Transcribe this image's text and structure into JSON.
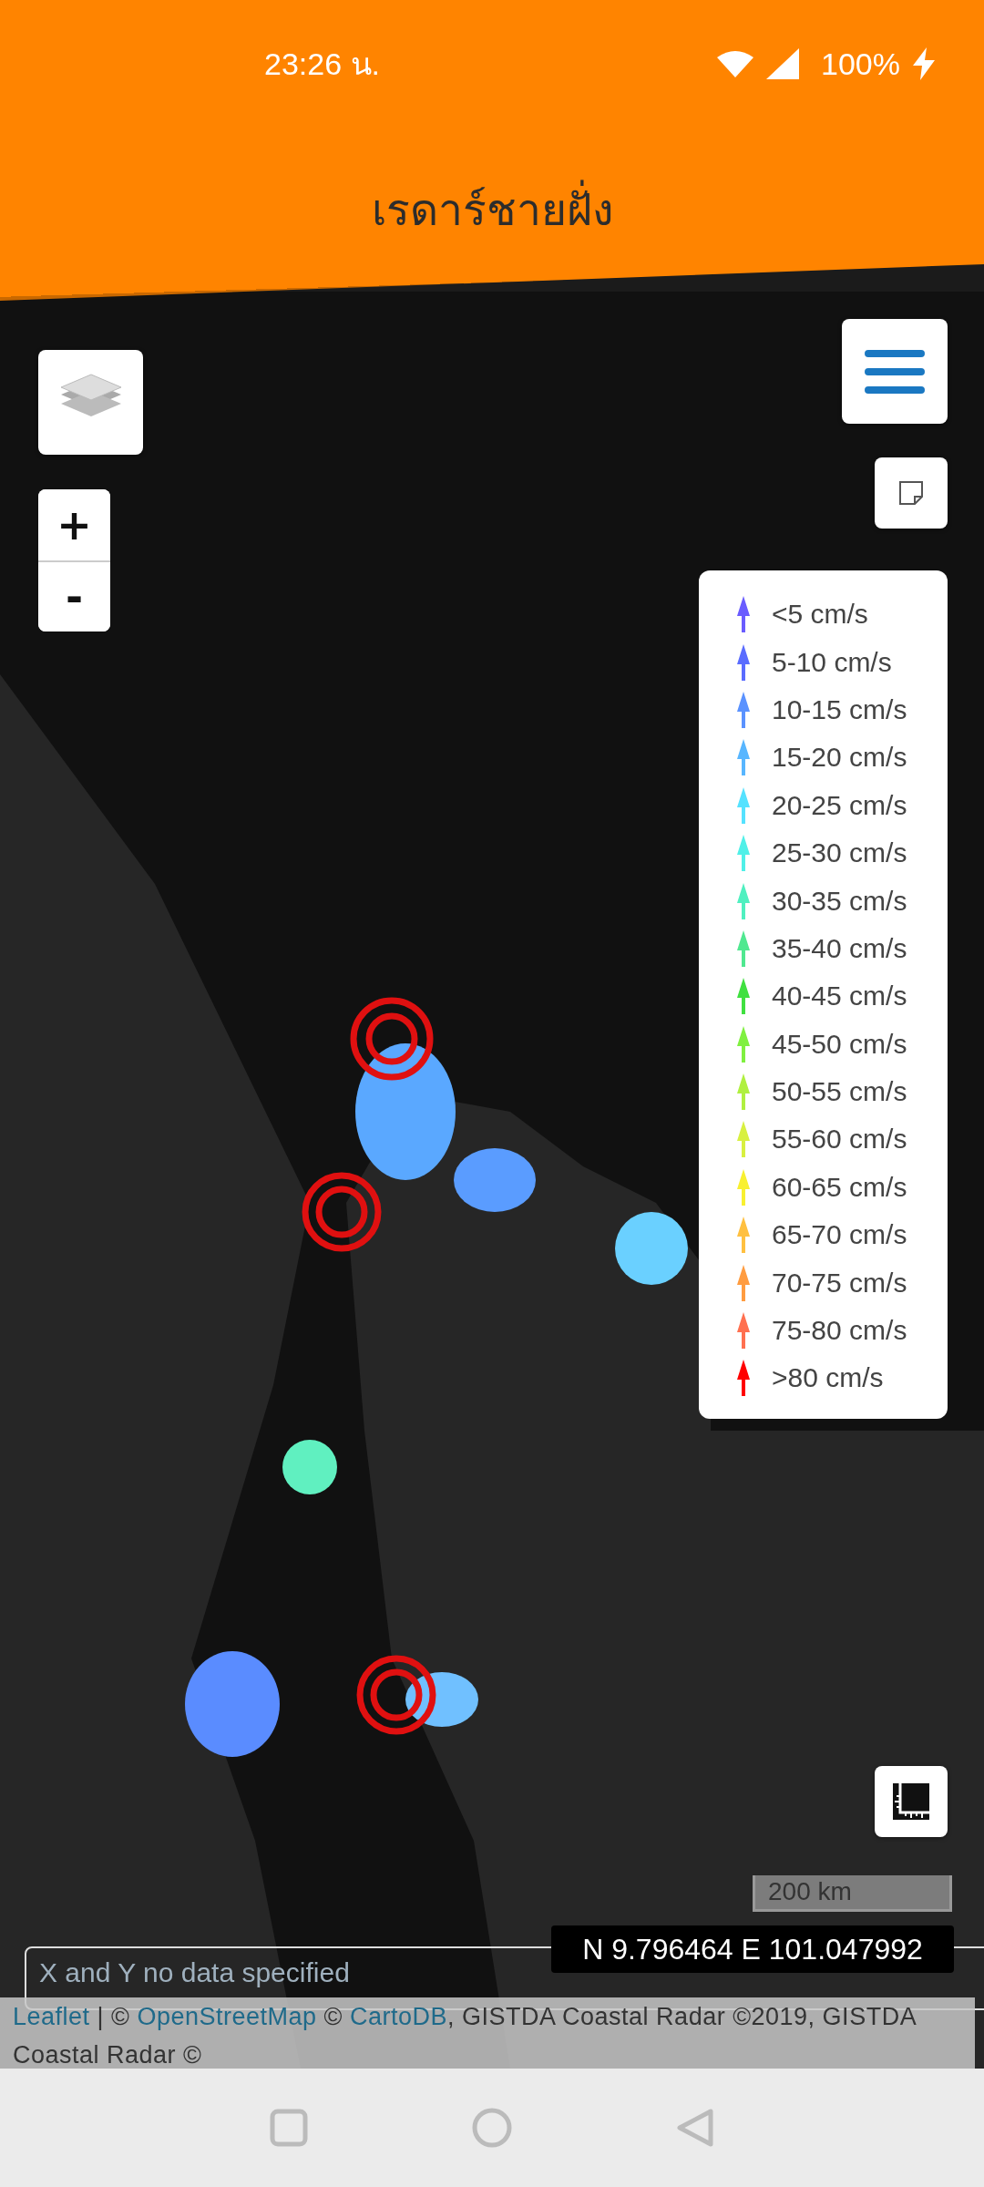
{
  "status_bar": {
    "time": "23:26 น.",
    "battery": "100%"
  },
  "header": {
    "title": "เรดาร์ชายฝั่ง"
  },
  "zoom": {
    "zoom_in": "+",
    "zoom_out": "-"
  },
  "legend": [
    {
      "label": "<5 cm/s",
      "color": "#6a5cff"
    },
    {
      "label": "5-10 cm/s",
      "color": "#5a6cff"
    },
    {
      "label": "10-15 cm/s",
      "color": "#5a92ff"
    },
    {
      "label": "15-20 cm/s",
      "color": "#58b6ff"
    },
    {
      "label": "20-25 cm/s",
      "color": "#55e2ff"
    },
    {
      "label": "25-30 cm/s",
      "color": "#50f0e8"
    },
    {
      "label": "30-35 cm/s",
      "color": "#50f0c0"
    },
    {
      "label": "35-40 cm/s",
      "color": "#50e890"
    },
    {
      "label": "40-45 cm/s",
      "color": "#40e040"
    },
    {
      "label": "45-50 cm/s",
      "color": "#80f040"
    },
    {
      "label": "50-55 cm/s",
      "color": "#b0f040"
    },
    {
      "label": "55-60 cm/s",
      "color": "#d8f040"
    },
    {
      "label": "60-65 cm/s",
      "color": "#f8f030"
    },
    {
      "label": "65-70 cm/s",
      "color": "#ffc040"
    },
    {
      "label": "70-75 cm/s",
      "color": "#ff9c40"
    },
    {
      "label": "75-80 cm/s",
      "color": "#ff7050"
    },
    {
      "label": ">80 cm/s",
      "color": "#ff0000"
    }
  ],
  "scale": "200 km",
  "coordinates": "N 9.796464 E 101.047992",
  "tooltip": "X and Y no data specified",
  "attribution": [
    {
      "kind": "link",
      "text": "Leaflet"
    },
    {
      "kind": "text",
      "text": " | © "
    },
    {
      "kind": "link",
      "text": "OpenStreetMap"
    },
    {
      "kind": "text",
      "text": " © "
    },
    {
      "kind": "link",
      "text": "CartoDB"
    },
    {
      "kind": "text",
      "text": ", GISTDA Coastal Radar ©2019, GISTDA Coastal Radar ©"
    }
  ]
}
